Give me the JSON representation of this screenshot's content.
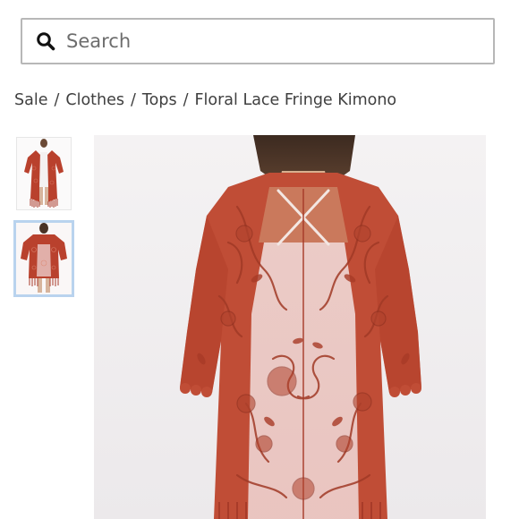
{
  "search": {
    "placeholder": "Search",
    "icon": "search-icon"
  },
  "breadcrumb": [
    {
      "label": "Sale"
    },
    {
      "label": "Clothes"
    },
    {
      "label": "Tops"
    },
    {
      "label": "Floral Lace Fringe Kimono"
    }
  ],
  "breadcrumb_separator": "/",
  "product": {
    "thumbnails": [
      {
        "view": "front",
        "selected": false
      },
      {
        "view": "back",
        "selected": true
      }
    ],
    "colors": {
      "lace": "#b8432f",
      "lining": "#f3e0df",
      "selected_border": "#b9d3ee"
    }
  }
}
